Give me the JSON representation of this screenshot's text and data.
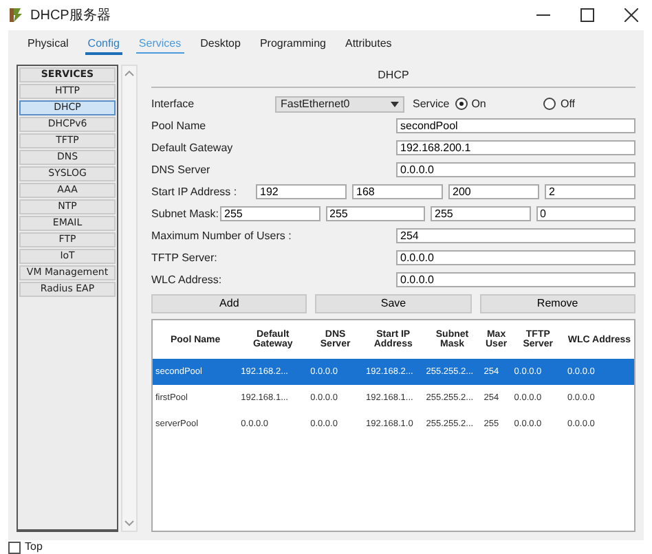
{
  "window": {
    "title": "DHCP服务器"
  },
  "tabs": [
    {
      "label": "Physical",
      "selected": false,
      "hover": false
    },
    {
      "label": "Config",
      "selected": true,
      "hover": false
    },
    {
      "label": "Services",
      "selected": false,
      "hover": true
    },
    {
      "label": "Desktop",
      "selected": false,
      "hover": false
    },
    {
      "label": "Programming",
      "selected": false,
      "hover": false
    },
    {
      "label": "Attributes",
      "selected": false,
      "hover": false
    }
  ],
  "sidebar": {
    "heading": "SERVICES",
    "items": [
      {
        "label": "HTTP",
        "selected": false
      },
      {
        "label": "DHCP",
        "selected": true
      },
      {
        "label": "DHCPv6",
        "selected": false
      },
      {
        "label": "TFTP",
        "selected": false
      },
      {
        "label": "DNS",
        "selected": false
      },
      {
        "label": "SYSLOG",
        "selected": false
      },
      {
        "label": "AAA",
        "selected": false
      },
      {
        "label": "NTP",
        "selected": false
      },
      {
        "label": "EMAIL",
        "selected": false
      },
      {
        "label": "FTP",
        "selected": false
      },
      {
        "label": "IoT",
        "selected": false
      },
      {
        "label": "VM Management",
        "selected": false
      },
      {
        "label": "Radius EAP",
        "selected": false
      }
    ]
  },
  "panel": {
    "title": "DHCP",
    "interface": {
      "label": "Interface",
      "value": "FastEthernet0"
    },
    "service": {
      "label": "Service",
      "options": [
        {
          "label": "On",
          "selected": true
        },
        {
          "label": "Off",
          "selected": false
        }
      ]
    },
    "fields": [
      {
        "label": "Pool Name",
        "value": "secondPool"
      },
      {
        "label": "Default Gateway",
        "value": "192.168.200.1"
      },
      {
        "label": "DNS Server",
        "value": "0.0.0.0"
      }
    ],
    "start_ip": {
      "label": "Start IP Address :",
      "octets": [
        "192",
        "168",
        "200",
        "2"
      ]
    },
    "subnet": {
      "label": "Subnet Mask:",
      "octets": [
        "255",
        "255",
        "255",
        "0"
      ]
    },
    "fields_2": [
      {
        "label": "Maximum Number of Users :",
        "value": "254"
      },
      {
        "label": "TFTP Server:",
        "value": "0.0.0.0"
      },
      {
        "label": "WLC Address:",
        "value": "0.0.0.0"
      }
    ],
    "buttons": [
      "Add",
      "Save",
      "Remove"
    ],
    "table": {
      "columns": [
        "Pool Name",
        "Default Gateway",
        "DNS Server",
        "Start IP Address",
        "Subnet Mask",
        "Max User",
        "TFTP Server",
        "WLC Address"
      ],
      "rows": [
        {
          "cells": [
            "secondPool",
            "192.168.2...",
            "0.0.0.0",
            "192.168.2...",
            "255.255.2...",
            "254",
            "0.0.0.0",
            "0.0.0.0"
          ],
          "selected": true
        },
        {
          "cells": [
            "firstPool",
            "192.168.1...",
            "0.0.0.0",
            "192.168.1...",
            "255.255.2...",
            "254",
            "0.0.0.0",
            "0.0.0.0"
          ],
          "selected": false
        },
        {
          "cells": [
            "serverPool",
            "0.0.0.0",
            "0.0.0.0",
            "192.168.1.0",
            "255.255.2...",
            "255",
            "0.0.0.0",
            "0.0.0.0"
          ],
          "selected": false
        }
      ]
    }
  },
  "footer": {
    "label": "Top",
    "checked": false
  }
}
